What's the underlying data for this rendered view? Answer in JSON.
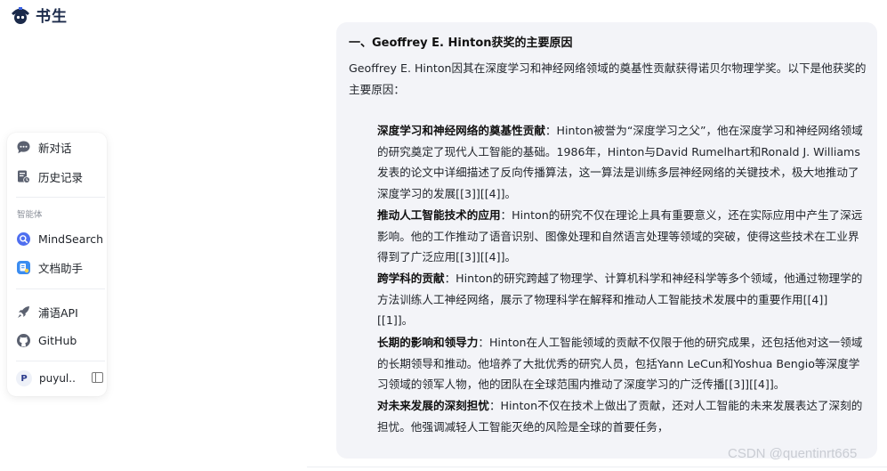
{
  "app": {
    "logo_text": "书生"
  },
  "sidebar": {
    "new_chat": "新对话",
    "history": "历史记录",
    "section_agents": "智能体",
    "agents": [
      {
        "label": "MindSearch",
        "icon": "mindsearch-icon"
      },
      {
        "label": "文档助手",
        "icon": "document-assistant-icon"
      }
    ],
    "links": [
      {
        "label": "浦语API",
        "icon": "api-rocket-icon"
      },
      {
        "label": "GitHub",
        "icon": "github-icon"
      }
    ],
    "user": {
      "avatar_letter": "P",
      "name": "puyul..."
    }
  },
  "message": {
    "heading": "一、Geoffrey E. Hinton获奖的主要原因",
    "intro": "Geoffrey E. Hinton因其在深度学习和神经网络领域的奠基性贡献获得诺贝尔物理学奖。以下是他获奖的主要原因：",
    "points": [
      {
        "title": "深度学习和神经网络的奠基性贡献",
        "sep": "：",
        "body": "Hinton被誉为“深度学习之父”，他在深度学习和神经网络领域的研究奠定了现代人工智能的基础。1986年，Hinton与David Rumelhart和Ronald J. Williams发表的论文中详细描述了反向传播算法，这一算法是训练多层神经网络的关键技术，极大地推动了深度学习的发展[[3]][[4]]。"
      },
      {
        "title": "推动人工智能技术的应用",
        "sep": "：",
        "body": "Hinton的研究不仅在理论上具有重要意义，还在实际应用中产生了深远影响。他的工作推动了语音识别、图像处理和自然语言处理等领域的突破，使得这些技术在工业界得到了广泛应用[[3]][[4]]。"
      },
      {
        "title": "跨学科的贡献",
        "sep": "：",
        "body": "Hinton的研究跨越了物理学、计算机科学和神经科学等多个领域，他通过物理学的方法训练人工神经网络，展示了物理科学在解释和推动人工智能技术发展中的重要作用[[4]][[1]]。"
      },
      {
        "title": "长期的影响和领导力",
        "sep": "：",
        "body": "Hinton在人工智能领域的贡献不仅限于他的研究成果，还包括他对这一领域的长期领导和推动。他培养了大批优秀的研究人员，包括Yann LeCun和Yoshua Bengio等深度学习领域的领军人物，他的团队在全球范围内推动了深度学习的广泛传播[[3]][[4]]。"
      },
      {
        "title": "对未来发展的深刻担忧",
        "sep": "：",
        "body": "Hinton不仅在技术上做出了贡献，还对人工智能的未来发展表达了深刻的担忧。他强调减轻人工智能灭绝的风险是全球的首要任务，"
      }
    ]
  },
  "watermark": "CSDN @quentinrt665",
  "colors": {
    "bubble_bg": "#f3f4f8",
    "accent": "#3b63e6",
    "text": "#1f2329"
  }
}
